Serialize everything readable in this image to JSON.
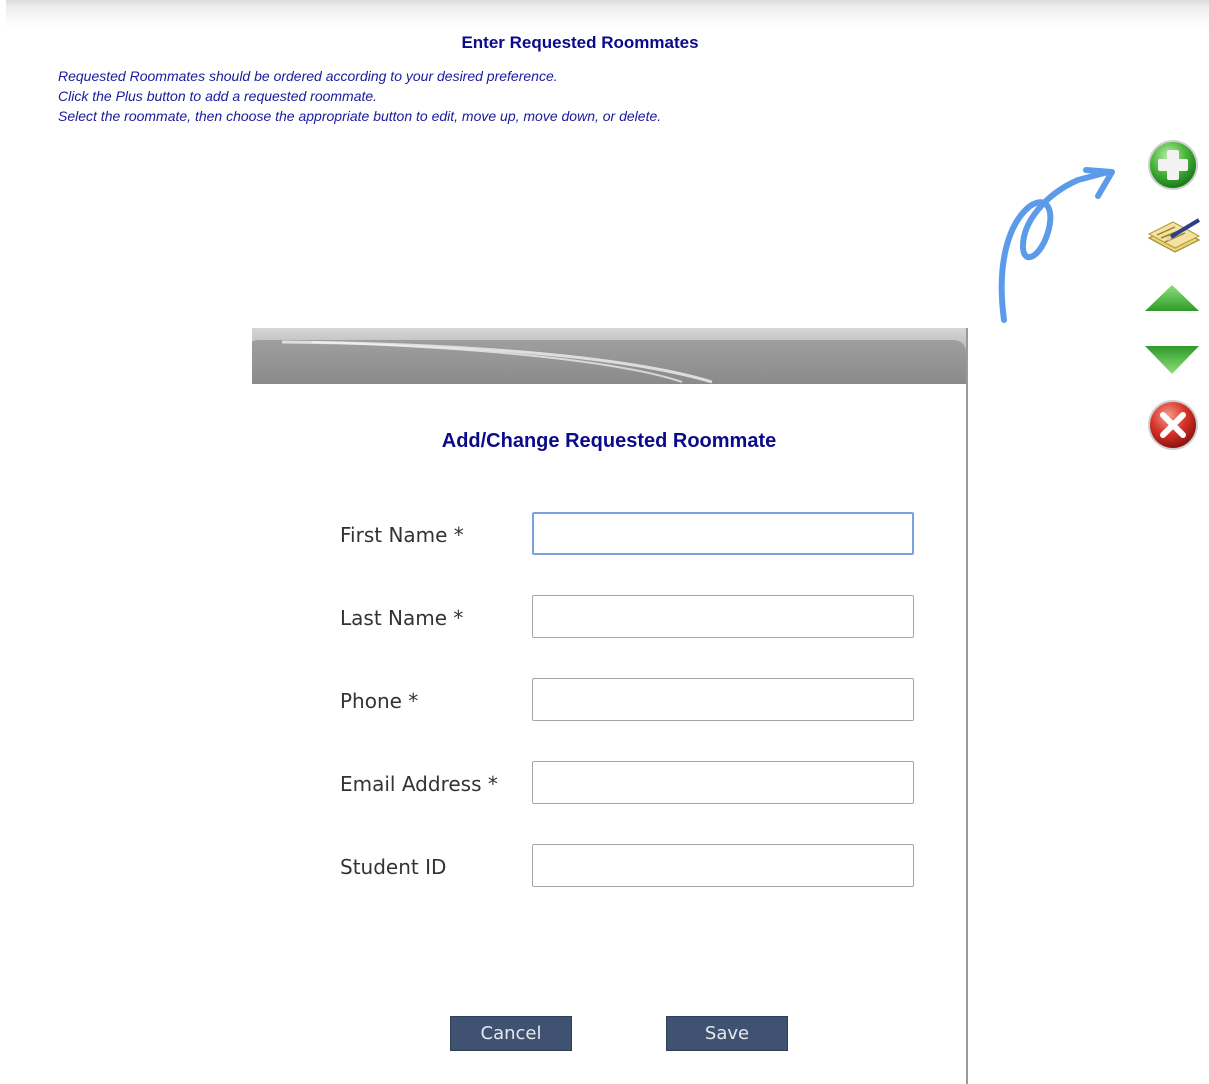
{
  "page": {
    "title": "Enter Requested Roommates",
    "instructions": [
      "Requested Roommates should be ordered according to your desired preference.",
      "Click the Plus button to add a requested roommate.",
      "Select the roommate, then choose the appropriate button to edit, move up, move down, or delete."
    ]
  },
  "toolbar": {
    "buttons": [
      {
        "icon": "plus-icon",
        "action": "add"
      },
      {
        "icon": "edit-icon",
        "action": "edit"
      },
      {
        "icon": "arrow-up-icon",
        "action": "move-up"
      },
      {
        "icon": "arrow-down-icon",
        "action": "move-down"
      },
      {
        "icon": "delete-icon",
        "action": "delete"
      }
    ]
  },
  "annotation": {
    "icon": "curved-arrow-icon",
    "color": "#5b9bea"
  },
  "modal": {
    "title": "Add/Change Requested Roommate",
    "fields": {
      "first_name": {
        "label": "First Name *",
        "value": "",
        "focused": true
      },
      "last_name": {
        "label": "Last Name *",
        "value": ""
      },
      "phone": {
        "label": "Phone *",
        "value": ""
      },
      "email": {
        "label": "Email Address *",
        "value": ""
      },
      "student_id": {
        "label": "Student ID",
        "value": ""
      }
    },
    "cancel_label": "Cancel",
    "save_label": "Save"
  },
  "colors": {
    "heading": "#0a0a8a",
    "instruction_text": "#1a1a9e",
    "button_bg": "#3f5271",
    "focus_border": "#7ba1e1"
  }
}
